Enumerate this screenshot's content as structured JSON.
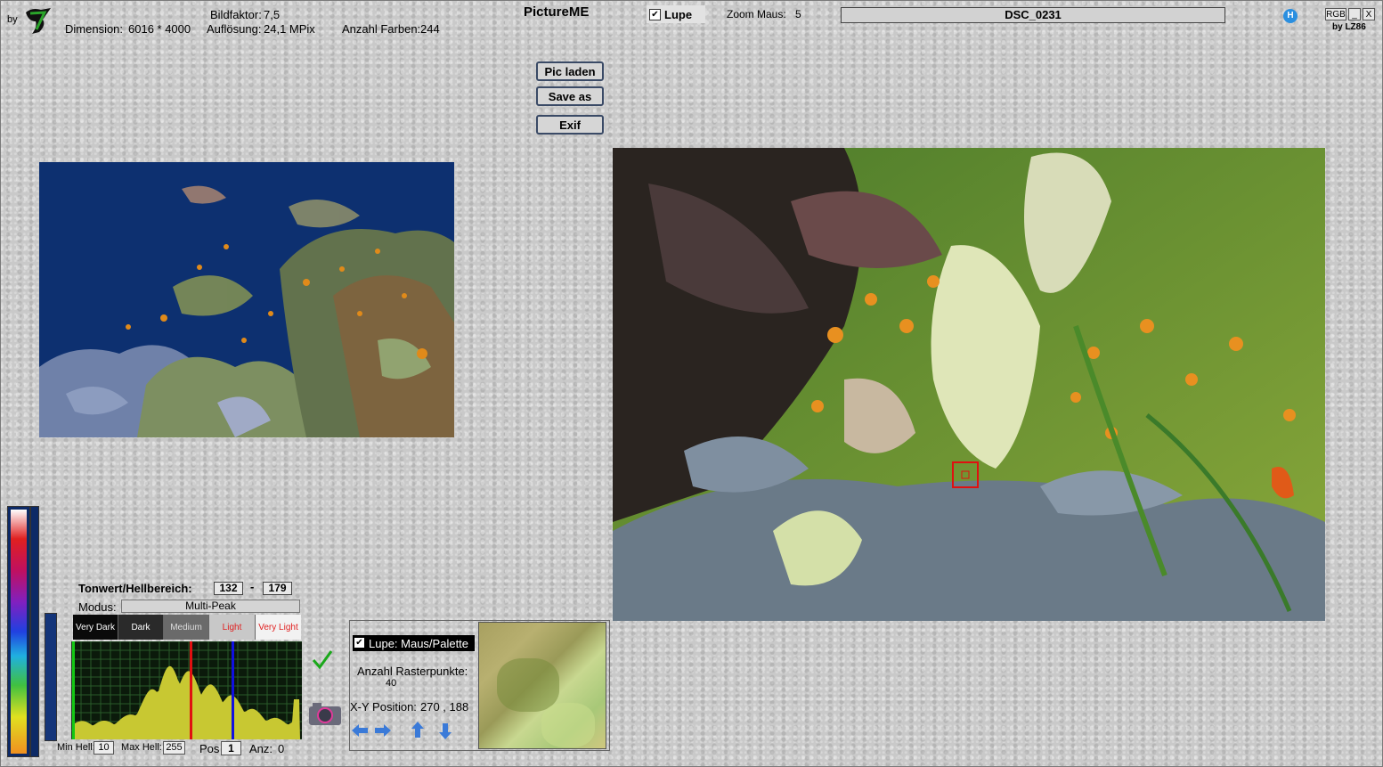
{
  "header": {
    "by_label": "by",
    "logo_icon": "lz-logo-icon",
    "dimension_label": "Dimension:",
    "dimension_value": "6016 * 4000",
    "bildfaktor_label": "Bildfaktor:",
    "bildfaktor_value": "7,5",
    "aufloesung_label": "Auflösung:",
    "aufloesung_value": "24,1 MPix",
    "anzahl_farben_label": "Anzahl Farben:",
    "anzahl_farben_value": "244",
    "app_title": "PictureME",
    "lupe_label": "Lupe",
    "lupe_checked": true,
    "zoom_label": "Zoom Maus:",
    "zoom_value": "5",
    "filename": "DSC_0231",
    "help_icon": "help-icon",
    "rgb_label": "RGB",
    "minimize_label": "_",
    "close_label": "X",
    "credit": "by LZ86"
  },
  "buttons": {
    "pic_laden": "Pic laden",
    "save_as": "Save as",
    "exif": "Exif"
  },
  "tonwert": {
    "label": "Tonwert/Hellbereich:",
    "from": "132",
    "sep": "-",
    "to": "179",
    "modus_label": "Modus:",
    "modus_value": "Multi-Peak",
    "ranges": [
      "Very Dark",
      "Dark",
      "Medium",
      "Light",
      "Very Light"
    ],
    "min_hell_label": "Min Hell:",
    "min_hell_value": "10",
    "max_hell_label": "Max Hell:",
    "max_hell_value": "255",
    "pos_label": "Pos",
    "pos_value": "1",
    "anz_label": "Anz:",
    "anz_value": "0"
  },
  "lupe_panel": {
    "checkbox_label": "Lupe: Maus/Palette",
    "checked": true,
    "raster_label": "Anzahl Rasterpunkte:",
    "raster_value": "40",
    "xy_label": "X-Y Position:",
    "xy_value": "270 , 188",
    "arrows": [
      "arrow-left-icon",
      "arrow-right-icon",
      "arrow-up-icon",
      "arrow-down-icon"
    ]
  },
  "icons": {
    "confirm": "checkmark-icon",
    "camera": "camera-icon"
  },
  "colors": {
    "posterized_background": "#0d3070",
    "histogram_fill": "#c8c832",
    "histogram_bg": "#0b1a0b",
    "marker_green": "#14c814",
    "marker_red": "#e01010",
    "marker_blue": "#1010e0"
  }
}
